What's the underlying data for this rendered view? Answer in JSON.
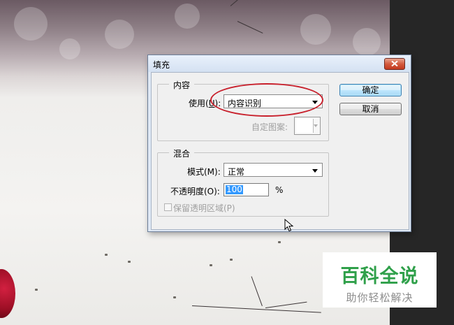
{
  "dialog": {
    "title": "填充",
    "close_icon": "close-icon",
    "content_group": {
      "legend": "内容",
      "use_label_pre": "使用(",
      "use_label_mn": "U",
      "use_label_post": "):",
      "use_value": "内容识别",
      "custom_pattern_label": "自定图案:"
    },
    "blend_group": {
      "legend": "混合",
      "mode_label": "模式(M):",
      "mode_value": "正常",
      "opacity_label": "不透明度(O):",
      "opacity_value": "100",
      "opacity_unit": "%",
      "preserve_transparency_label": "保留透明区域(P)",
      "preserve_transparency_checked": false
    },
    "buttons": {
      "ok": "确定",
      "cancel": "取消"
    }
  },
  "watermark": {
    "title": "百科全说",
    "subtitle": "助你轻松解决"
  },
  "colors": {
    "annotation_ellipse": "#c8202c",
    "watermark_green": "#2fa04a",
    "selection_blue": "#3399ff"
  }
}
